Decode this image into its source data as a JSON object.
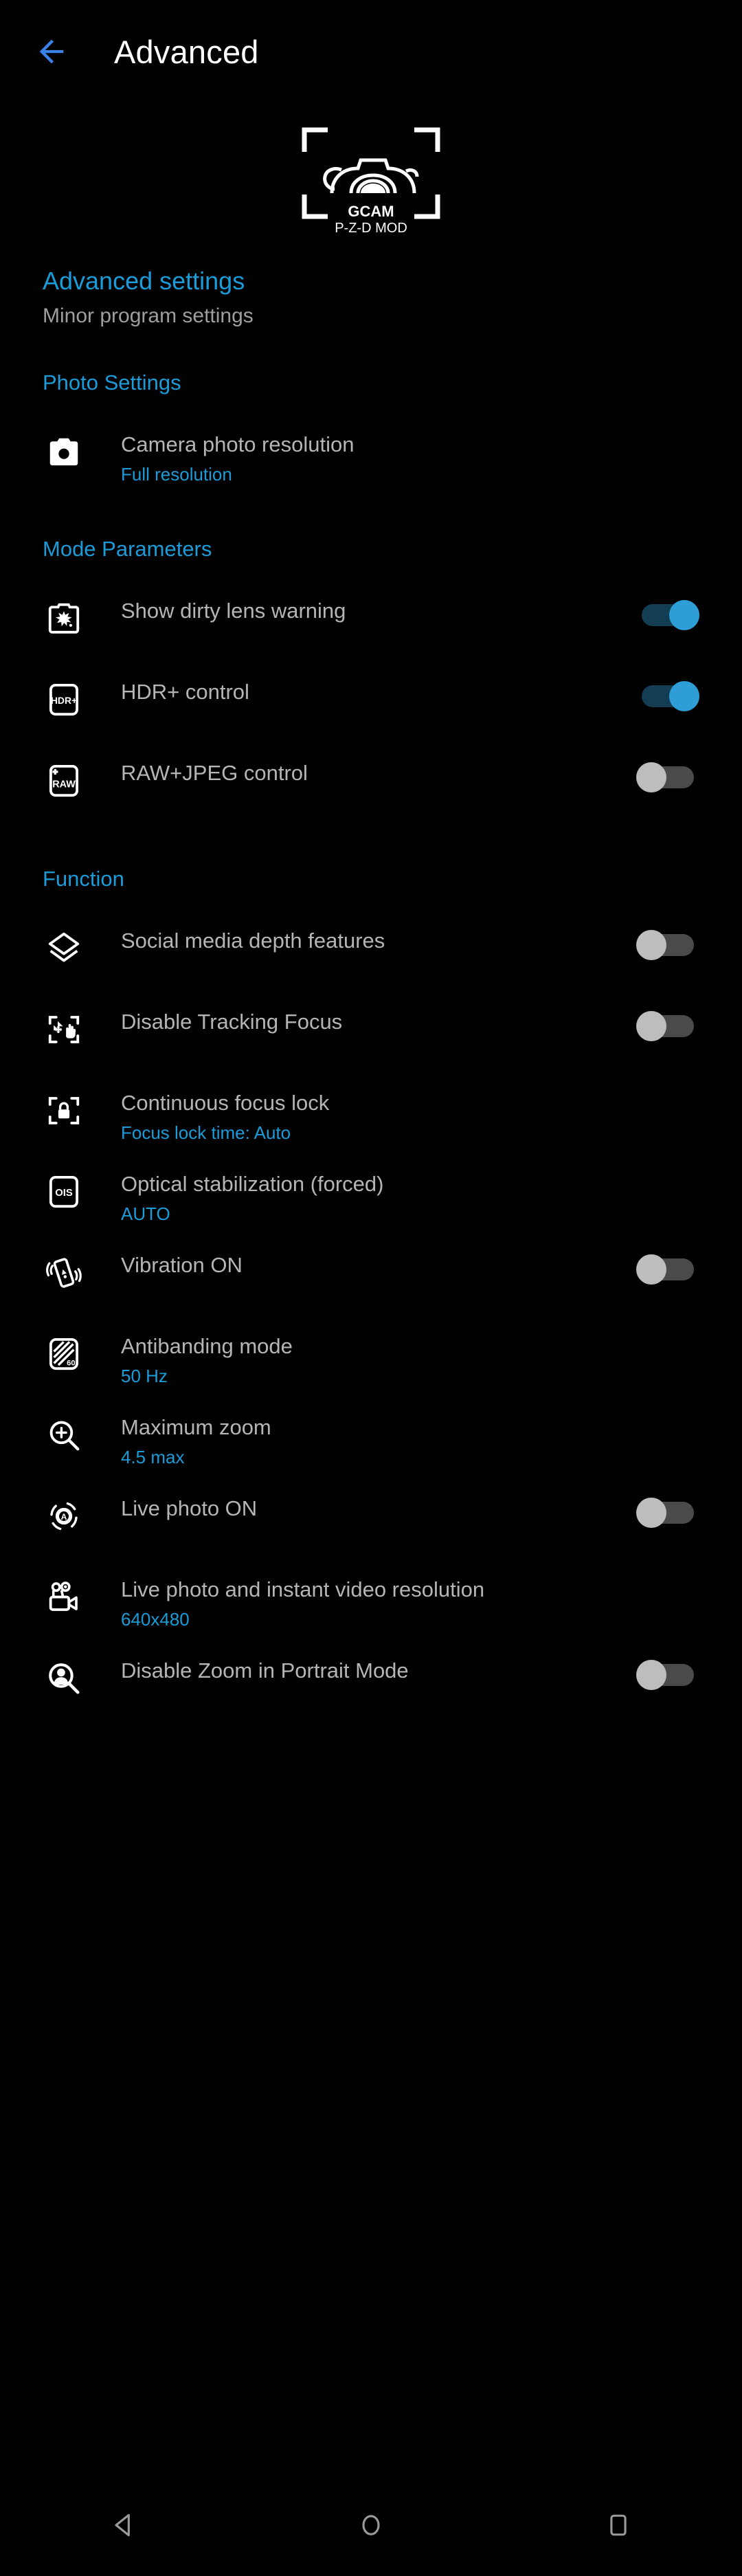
{
  "appbar": {
    "back_icon": "arrow-left-icon",
    "title": "Advanced"
  },
  "logo": {
    "brand": "GCAM",
    "subtitle": "P-Z-D MOD",
    "icon": "camera-logo-icon"
  },
  "intro": {
    "title": "Advanced settings",
    "subtitle": "Minor program settings"
  },
  "colors": {
    "accent": "#1b9bd8",
    "switch_on_thumb": "#2f9dd6",
    "switch_on_track": "#133d52",
    "switch_off_thumb": "#bdbdbd",
    "switch_off_track": "#4a4a4a",
    "label": "#b5b5b5",
    "background": "#000000"
  },
  "sections": [
    {
      "heading": "Photo Settings",
      "rows": [
        {
          "icon": "camera-icon",
          "label": "Camera photo resolution",
          "value": "Full resolution",
          "switch": null
        }
      ]
    },
    {
      "heading": "Mode Parameters",
      "rows": [
        {
          "icon": "dirty-lens-icon",
          "label": "Show dirty lens warning",
          "value": null,
          "switch": "on"
        },
        {
          "icon": "hdr-plus-icon",
          "label": "HDR+ control",
          "value": null,
          "switch": "on"
        },
        {
          "icon": "raw-icon",
          "label": "RAW+JPEG control",
          "value": null,
          "switch": "off"
        }
      ]
    },
    {
      "heading": "Function",
      "rows": [
        {
          "icon": "layers-icon",
          "label": "Social media depth features",
          "value": null,
          "switch": "off"
        },
        {
          "icon": "tracking-focus-icon",
          "label": "Disable Tracking Focus",
          "value": null,
          "switch": "off"
        },
        {
          "icon": "focus-lock-icon",
          "label": "Continuous focus lock",
          "value": "Focus lock time: Auto",
          "switch": null
        },
        {
          "icon": "ois-icon",
          "label": "Optical stabilization (forced)",
          "value": "AUTO",
          "switch": null
        },
        {
          "icon": "vibration-icon",
          "label": "Vibration ON",
          "value": null,
          "switch": "off"
        },
        {
          "icon": "antibanding-icon",
          "label": "Antibanding mode",
          "value": "50 Hz",
          "switch": null
        },
        {
          "icon": "zoom-in-icon",
          "label": "Maximum zoom",
          "value": "4.5 max",
          "switch": null
        },
        {
          "icon": "live-photo-icon",
          "label": "Live photo ON",
          "value": null,
          "switch": "off"
        },
        {
          "icon": "video-camera-icon",
          "label": "Live photo and instant video resolution",
          "value": "640x480",
          "switch": null
        },
        {
          "icon": "portrait-zoom-icon",
          "label": "Disable Zoom in Portrait Mode",
          "value": null,
          "switch": "off"
        }
      ]
    }
  ],
  "navbar": {
    "back": "nav-back-icon",
    "home": "nav-home-icon",
    "recents": "nav-recents-icon"
  }
}
